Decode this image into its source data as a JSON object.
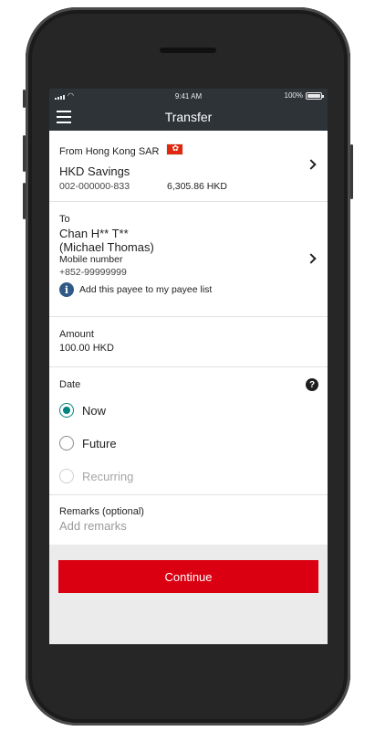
{
  "status_bar": {
    "time": "9:41 AM",
    "battery": "100%"
  },
  "app_bar": {
    "title": "Transfer",
    "menu_icon": "hamburger-icon"
  },
  "from": {
    "label": "From Hong Kong SAR",
    "flag_icon": "hk-flag-icon",
    "account_name": "HKD Savings",
    "account_number": "002-000000-833",
    "balance": "6,305.86 HKD"
  },
  "to": {
    "label": "To",
    "payee_name": "Chan H** T**",
    "payee_alias": "(Michael Thomas)",
    "method": "Mobile number",
    "phone": "+852-99999999",
    "add_payee": "Add this payee to my payee list"
  },
  "amount": {
    "label": "Amount",
    "value": "100.00 HKD"
  },
  "date": {
    "label": "Date",
    "options": [
      {
        "label": "Now",
        "selected": true,
        "disabled": false
      },
      {
        "label": "Future",
        "selected": false,
        "disabled": false
      },
      {
        "label": "Recurring",
        "selected": false,
        "disabled": true
      }
    ]
  },
  "remarks": {
    "label": "Remarks (optional)",
    "placeholder": "Add remarks"
  },
  "continue_label": "Continue",
  "colors": {
    "accent": "#db0011",
    "radio": "#00847f",
    "header": "#2e3338"
  }
}
